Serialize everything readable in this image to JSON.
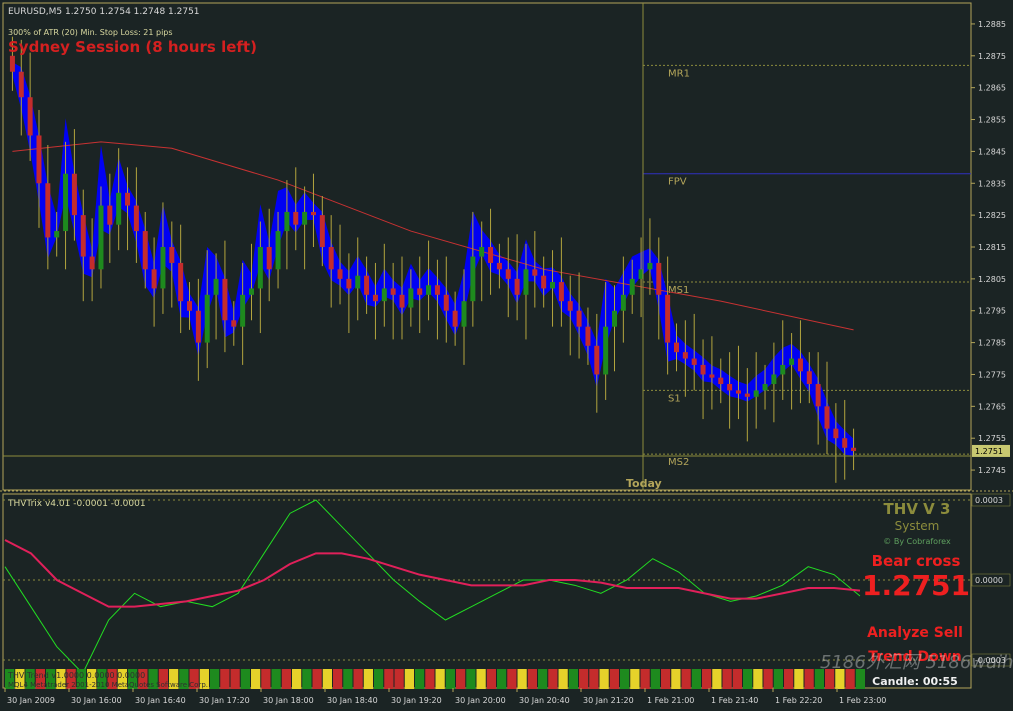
{
  "header": {
    "symbol_line": "EURUSD,M5  1.2750 1.2754 1.2748 1.2751",
    "atr_line": "300% of ATR (20)     Min. Stop Loss:   21 pips",
    "session_label": "Sydney Session (8 hours left)"
  },
  "chart_data": [
    {
      "type": "candlestick",
      "title": "EURUSD,M5",
      "ohlc_current": {
        "open": 1.275,
        "high": 1.2754,
        "low": 1.2748,
        "close": 1.2751
      },
      "ylim": [
        1.274,
        1.289
      ],
      "y_ticks": [
        "1.2885",
        "1.2875",
        "1.2865",
        "1.2855",
        "1.2845",
        "1.2835",
        "1.2825",
        "1.2815",
        "1.2805",
        "1.2795",
        "1.2785",
        "1.2775",
        "1.2765",
        "1.2755",
        "1.2745"
      ],
      "current_price_label": "1.2751",
      "closes": [
        1.287,
        1.2862,
        1.285,
        1.2835,
        1.2818,
        1.282,
        1.2838,
        1.2825,
        1.2812,
        1.2808,
        1.2828,
        1.2822,
        1.2832,
        1.2828,
        1.282,
        1.2808,
        1.2802,
        1.2815,
        1.281,
        1.2798,
        1.2795,
        1.2785,
        1.28,
        1.2805,
        1.2792,
        1.279,
        1.28,
        1.2802,
        1.2815,
        1.2808,
        1.282,
        1.2826,
        1.2822,
        1.2826,
        1.2825,
        1.2815,
        1.2808,
        1.2805,
        1.2802,
        1.2806,
        1.28,
        1.2798,
        1.2802,
        1.28,
        1.2796,
        1.2802,
        1.28,
        1.2803,
        1.28,
        1.2795,
        1.279,
        1.2798,
        1.2812,
        1.2815,
        1.281,
        1.2808,
        1.2805,
        1.28,
        1.2808,
        1.2806,
        1.2802,
        1.2804,
        1.2798,
        1.2795,
        1.279,
        1.2784,
        1.2775,
        1.279,
        1.2795,
        1.28,
        1.2805,
        1.2808,
        1.281,
        1.28,
        1.2785,
        1.2782,
        1.278,
        1.2778,
        1.2775,
        1.2774,
        1.2772,
        1.277,
        1.2769,
        1.2768,
        1.277,
        1.2772,
        1.2775,
        1.2778,
        1.278,
        1.2776,
        1.2772,
        1.2765,
        1.2758,
        1.2755,
        1.2752,
        1.2751
      ],
      "moving_average": [
        {
          "x": 0,
          "y": 1.2845
        },
        {
          "x": 10,
          "y": 1.2848
        },
        {
          "x": 18,
          "y": 1.2846
        },
        {
          "x": 30,
          "y": 1.2836
        },
        {
          "x": 45,
          "y": 1.282
        },
        {
          "x": 60,
          "y": 1.2808
        },
        {
          "x": 70,
          "y": 1.2803
        },
        {
          "x": 80,
          "y": 1.2798
        },
        {
          "x": 95,
          "y": 1.2789
        }
      ],
      "levels": [
        {
          "name": "MR1",
          "value": 1.2872
        },
        {
          "name": "FPV",
          "value": 1.2838
        },
        {
          "name": "MS1",
          "value": 1.2804
        },
        {
          "name": "S1",
          "value": 1.277
        },
        {
          "name": "MS2",
          "value": 1.275
        }
      ],
      "today_label": "Today",
      "colors": {
        "bull": "#1e8a1e",
        "bear": "#c42c2c",
        "wick": "#b3a53e",
        "cloud": "#0000ff",
        "ma": "#c83232",
        "level": "#8c8c3c"
      }
    },
    {
      "type": "line",
      "title": "THVTrix v4.01 -0.0001 -0.0001",
      "ylim": [
        -0.0003,
        0.0003
      ],
      "y_ticks": [
        "0.0003",
        "0.0000",
        "-0.0003"
      ],
      "series": [
        {
          "color": "#22dd22",
          "values": [
            5e-05,
            -0.0001,
            -0.00025,
            -0.00035,
            -0.00015,
            -5e-05,
            -0.0001,
            -8e-05,
            -0.0001,
            -5e-05,
            0.0001,
            0.00025,
            0.0003,
            0.0002,
            0.0001,
            0.0,
            -8e-05,
            -0.00015,
            -0.0001,
            -5e-05,
            0.0,
            0.0,
            -2e-05,
            -5e-05,
            0.0,
            8e-05,
            3e-05,
            -5e-05,
            -8e-05,
            -6e-05,
            -2e-05,
            5e-05,
            2e-05,
            -6e-05
          ]
        },
        {
          "color": "#e0205a",
          "values": [
            0.00015,
            0.0001,
            0.0,
            -5e-05,
            -0.0001,
            -0.0001,
            -9e-05,
            -8e-05,
            -6e-05,
            -4e-05,
            0.0,
            6e-05,
            0.0001,
            0.0001,
            8e-05,
            5e-05,
            2e-05,
            0.0,
            -2e-05,
            -2e-05,
            -2e-05,
            0.0,
            0.0,
            -1e-05,
            -3e-05,
            -3e-05,
            -3e-05,
            -5e-05,
            -7e-05,
            -7e-05,
            -5e-05,
            -3e-05,
            -3e-05,
            -4e-05
          ]
        }
      ],
      "color_bar": [
        "green",
        "yellow",
        "green",
        "red",
        "green",
        "yellow",
        "red",
        "green",
        "yellow",
        "green",
        "red",
        "yellow",
        "green",
        "red",
        "green",
        "red",
        "yellow",
        "green",
        "red",
        "yellow",
        "green",
        "red",
        "red",
        "green",
        "yellow",
        "red",
        "green",
        "red",
        "yellow",
        "green",
        "red",
        "yellow",
        "red",
        "green",
        "red",
        "yellow",
        "green",
        "red",
        "red",
        "yellow",
        "green",
        "red",
        "yellow",
        "green",
        "red",
        "green",
        "yellow",
        "red",
        "green",
        "red",
        "yellow",
        "red",
        "green",
        "red",
        "yellow",
        "green",
        "red",
        "red",
        "yellow",
        "red",
        "green",
        "yellow",
        "red",
        "green",
        "red",
        "yellow",
        "red",
        "green",
        "red",
        "yellow",
        "red",
        "red",
        "green",
        "yellow",
        "red",
        "green",
        "red",
        "yellow",
        "red",
        "green",
        "red",
        "yellow",
        "red",
        "green"
      ],
      "footer_text": "THV Trend v1.0000 0.0000 0.0000",
      "copyright_text": "MQL4 Metatrader 2001-2010 MetaQuotes Software Corp."
    }
  ],
  "x_ticks": [
    "30 Jan 2009",
    "30 Jan 16:00",
    "30 Jan 16:40",
    "30 Jan 17:20",
    "30 Jan 18:00",
    "30 Jan 18:40",
    "30 Jan 19:20",
    "30 Jan 20:00",
    "30 Jan 20:40",
    "30 Jan 21:20",
    "1 Feb 21:00",
    "1 Feb 21:40",
    "1 Feb 22:20",
    "1 Feb 23:00"
  ],
  "panel": {
    "brand": "THV V 3",
    "system": "System",
    "by": "© By Cobraforex",
    "signal": "Bear cross",
    "price": "1.2751",
    "analyze": "Analyze Sell",
    "trend": "Trend Down",
    "candle": "Candle:  00:55"
  },
  "watermark": "5186外汇网 5186waihui.com"
}
